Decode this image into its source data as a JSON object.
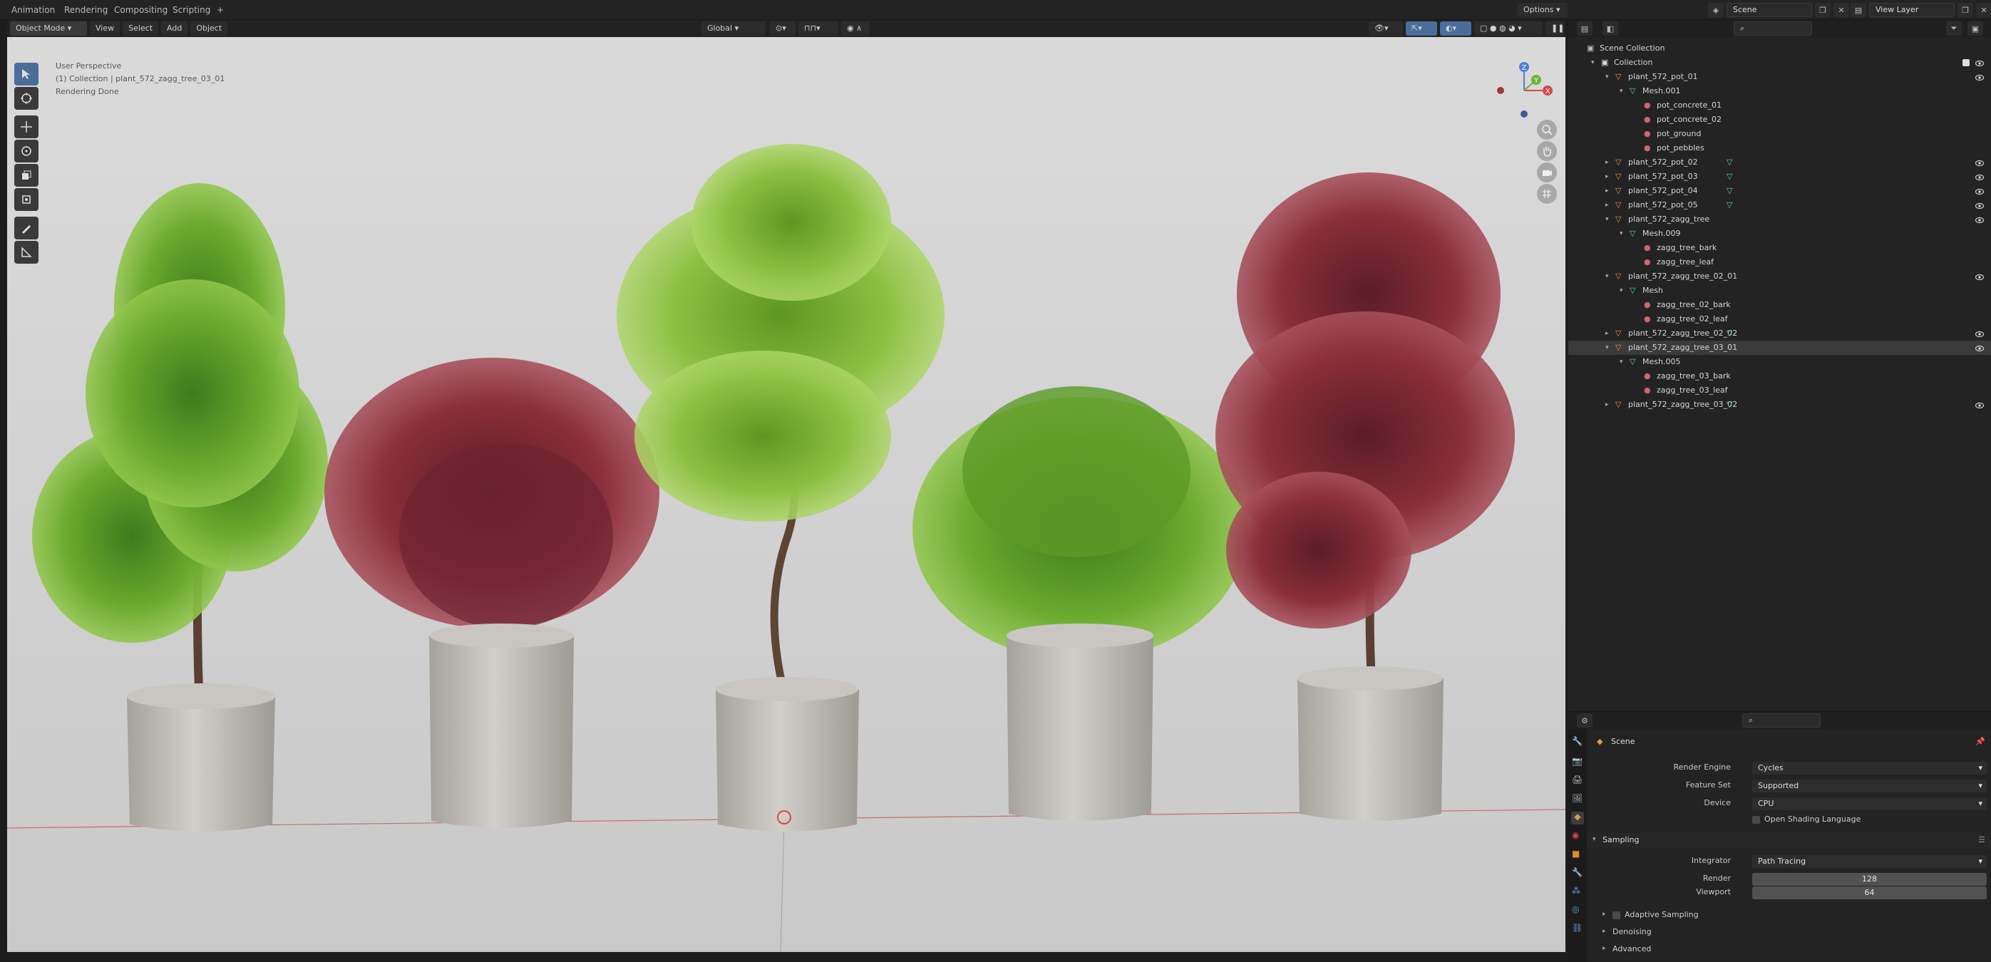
{
  "topbar": {
    "tabs": [
      "Animation",
      "Rendering",
      "Compositing",
      "Scripting",
      "+"
    ],
    "scene_name": "Scene",
    "view_layer": "View Layer"
  },
  "viewport_header": {
    "mode": "Object Mode",
    "menus": [
      "View",
      "Select",
      "Add",
      "Object"
    ],
    "orientation": "Global",
    "options_label": "Options"
  },
  "viewport": {
    "overlay_line1": "User Perspective",
    "overlay_line2": "(1) Collection | plant_572_zagg_tree_03_01",
    "overlay_line3": "Rendering Done",
    "gizmo_axes": [
      "Z",
      "Y",
      "X"
    ]
  },
  "outliner": {
    "search_placeholder": "",
    "rows": [
      {
        "label": "Scene Collection",
        "indent": 0,
        "type": "scene",
        "arrow": ""
      },
      {
        "label": "Collection",
        "indent": 1,
        "type": "collection",
        "arrow": "▾"
      },
      {
        "label": "plant_572_pot_01",
        "indent": 2,
        "type": "object",
        "arrow": "▾"
      },
      {
        "label": "Mesh.001",
        "indent": 3,
        "type": "mesh",
        "arrow": "▾"
      },
      {
        "label": "pot_concrete_01",
        "indent": 4,
        "type": "material",
        "arrow": ""
      },
      {
        "label": "pot_concrete_02",
        "indent": 4,
        "type": "material",
        "arrow": ""
      },
      {
        "label": "pot_ground",
        "indent": 4,
        "type": "material",
        "arrow": ""
      },
      {
        "label": "pot_pebbles",
        "indent": 4,
        "type": "material",
        "arrow": ""
      },
      {
        "label": "plant_572_pot_02",
        "indent": 2,
        "type": "object",
        "arrow": "▸"
      },
      {
        "label": "plant_572_pot_03",
        "indent": 2,
        "type": "object",
        "arrow": "▸"
      },
      {
        "label": "plant_572_pot_04",
        "indent": 2,
        "type": "object",
        "arrow": "▸"
      },
      {
        "label": "plant_572_pot_05",
        "indent": 2,
        "type": "object",
        "arrow": "▸"
      },
      {
        "label": "plant_572_zagg_tree",
        "indent": 2,
        "type": "object",
        "arrow": "▾"
      },
      {
        "label": "Mesh.009",
        "indent": 3,
        "type": "mesh",
        "arrow": "▾"
      },
      {
        "label": "zagg_tree_bark",
        "indent": 4,
        "type": "material",
        "arrow": ""
      },
      {
        "label": "zagg_tree_leaf",
        "indent": 4,
        "type": "material",
        "arrow": ""
      },
      {
        "label": "plant_572_zagg_tree_02_01",
        "indent": 2,
        "type": "object",
        "arrow": "▾"
      },
      {
        "label": "Mesh",
        "indent": 3,
        "type": "mesh",
        "arrow": "▾"
      },
      {
        "label": "zagg_tree_02_bark",
        "indent": 4,
        "type": "material",
        "arrow": ""
      },
      {
        "label": "zagg_tree_02_leaf",
        "indent": 4,
        "type": "material",
        "arrow": ""
      },
      {
        "label": "plant_572_zagg_tree_02_02",
        "indent": 2,
        "type": "object",
        "arrow": "▸"
      },
      {
        "label": "plant_572_zagg_tree_03_01",
        "indent": 2,
        "type": "object",
        "arrow": "▾"
      },
      {
        "label": "Mesh.005",
        "indent": 3,
        "type": "mesh",
        "arrow": "▾"
      },
      {
        "label": "zagg_tree_03_bark",
        "indent": 4,
        "type": "material",
        "arrow": ""
      },
      {
        "label": "zagg_tree_03_leaf",
        "indent": 4,
        "type": "material",
        "arrow": ""
      },
      {
        "label": "plant_572_zagg_tree_03_02",
        "indent": 2,
        "type": "object",
        "arrow": "▸"
      }
    ]
  },
  "properties": {
    "context": "Scene",
    "render_engine_label": "Render Engine",
    "render_engine": "Cycles",
    "feature_set_label": "Feature Set",
    "feature_set": "Supported",
    "device_label": "Device",
    "device": "CPU",
    "osl_label": "Open Shading Language",
    "sampling_label": "Sampling",
    "integrator_label": "Integrator",
    "integrator": "Path Tracing",
    "render_label": "Render",
    "render_samples": "128",
    "viewport_label": "Viewport",
    "viewport_samples": "64",
    "adaptive_label": "Adaptive Sampling",
    "denoising_label": "Denoising",
    "advanced_label": "Advanced"
  },
  "colors": {
    "accent": "#4b6d9a",
    "leaf_green": "#6aa92e",
    "leaf_red": "#8a2e3a",
    "pot": "#bdbab5"
  }
}
